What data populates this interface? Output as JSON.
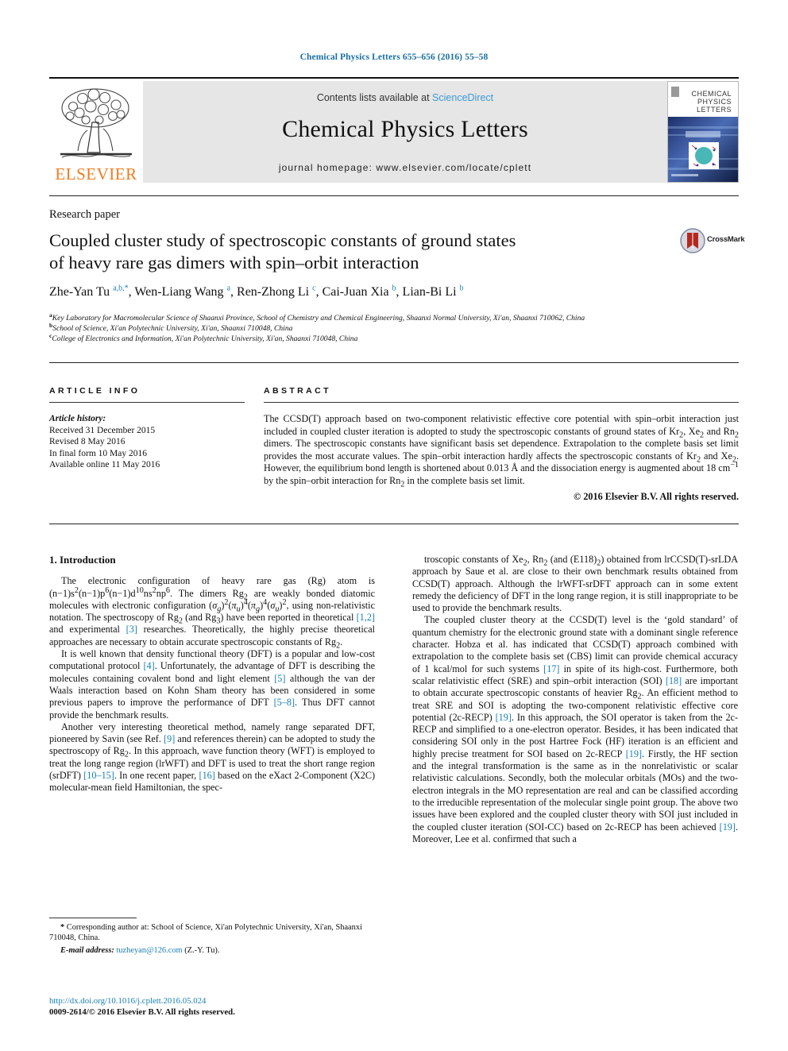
{
  "running_head": "Chemical Physics Letters 655–656 (2016) 55–58",
  "masthead": {
    "publisher_name": "ELSEVIER",
    "contents_prefix": "Contents lists available at ",
    "sciencedirect": "ScienceDirect",
    "journal_title": "Chemical Physics Letters",
    "homepage": "journal homepage: www.elsevier.com/locate/cplett",
    "cover_title_line1": "CHEMICAL",
    "cover_title_line2": "PHYSICS",
    "cover_title_line3": "LETTERS"
  },
  "article": {
    "type": "Research paper",
    "title_line1": "Coupled cluster study of spectroscopic constants of ground states",
    "title_line2": "of heavy rare gas dimers with spin–orbit interaction",
    "crossmark_label": "CrossMark",
    "authors_html": "Zhe-Yan Tu <sup>a,b,</sup><sup>*</sup>, Wen-Liang Wang <sup>a</sup>, Ren-Zhong Li <sup>c</sup>, Cai-Juan Xia <sup>b</sup>, Lian-Bi Li <sup>b</sup>",
    "affiliations": [
      {
        "mark": "a",
        "text": "Key Laboratory for Macromolecular Science of Shaanxi Province, School of Chemistry and Chemical Engineering, Shaanxi Normal University, Xi'an, Shaanxi 710062, China"
      },
      {
        "mark": "b",
        "text": "School of Science, Xi'an Polytechnic University, Xi'an, Shaanxi 710048, China"
      },
      {
        "mark": "c",
        "text": "College of Electronics and Information, Xi'an Polytechnic University, Xi'an, Shaanxi 710048, China"
      }
    ]
  },
  "article_info": {
    "heading": "ARTICLE INFO",
    "history_label": "Article history:",
    "history": [
      "Received 31 December 2015",
      "Revised 8 May 2016",
      "In final form 10 May 2016",
      "Available online 11 May 2016"
    ]
  },
  "abstract": {
    "heading": "ABSTRACT",
    "body_html": "The CCSD(T) approach based on two-component relativistic effective core potential with spin–orbit interaction just included in coupled cluster iteration is adopted to study the spectroscopic constants of ground states of Kr<sub>2</sub>, Xe<sub>2</sub> and Rn<sub>2</sub> dimers. The spectroscopic constants have significant basis set dependence. Extrapolation to the complete basis set limit provides the most accurate values. The spin–orbit interaction hardly affects the spectroscopic constants of Kr<sub>2</sub> and Xe<sub>2</sub>. However, the equilibrium bond length is shortened about 0.013 Å and the dissociation energy is augmented about 18 cm<sup>−1</sup> by the spin–orbit interaction for Rn<sub>2</sub> in the complete basis set limit.",
    "copyright": "© 2016 Elsevier B.V. All rights reserved."
  },
  "body": {
    "section_number_title": "1. Introduction",
    "left_paragraphs_html": [
      "The electronic configuration of heavy rare gas (Rg) atom is (n−1)s<sup>2</sup>(n−1)p<sup>6</sup>(n−1)d<sup>10</sup>ns<sup>2</sup>np<sup>6</sup>. The dimers Rg<sub>2</sub> are weakly bonded diatomic molecules with electronic configuration (<i>σ<sub>g</sub></i>)<sup>2</sup>(<i>π<sub>u</sub></i>)<sup>4</sup>(<i>π<sub>g</sub></i>)<sup>4</sup>(<i>σ<sub>u</sub></i>)<sup>2</sup>, using non-relativistic notation. The spectroscopy of Rg<sub>2</sub> (and Rg<sub>3</sub>) have been reported in theoretical <span class=\"ref\">[1,2]</span> and experimental <span class=\"ref\">[3]</span> researches. Theoretically, the highly precise theoretical approaches are necessary to obtain accurate spectroscopic constants of Rg<sub>2</sub>.",
      "It is well known that density functional theory (DFT) is a popular and low-cost computational protocol <span class=\"ref\">[4]</span>. Unfortunately, the advantage of DFT is describing the molecules containing covalent bond and light element <span class=\"ref\">[5]</span> although the van der Waals interaction based on Kohn Sham theory has been considered in some previous papers to improve the performance of DFT <span class=\"ref\">[5–8]</span>. Thus DFT cannot provide the benchmark results.",
      "Another very interesting theoretical method, namely range separated DFT, pioneered by Savin (see Ref. <span class=\"ref\">[9]</span> and references therein) can be adopted to study the spectroscopy of Rg<sub>2</sub>. In this approach, wave function theory (WFT) is employed to treat the long range region (lrWFT) and DFT is used to treat the short range region (srDFT) <span class=\"ref\">[10–15]</span>. In one recent paper, <span class=\"ref\">[16]</span> based on the eXact 2-Component (X2C) molecular-mean field Hamiltonian, the spec-"
    ],
    "right_paragraphs_html": [
      "troscopic constants of Xe<sub>2</sub>, Rn<sub>2</sub> (and (E118)<sub>2</sub>) obtained from lrCCSD(T)-srLDA approach by Saue et al. are close to their own benchmark results obtained from CCSD(T) approach. Although the lrWFT-srDFT approach can in some extent remedy the deficiency of DFT in the long range region, it is still inappropriate to be used to provide the benchmark results.",
      "The coupled cluster theory at the CCSD(T) level is the ‘gold standard’ of quantum chemistry for the electronic ground state with a dominant single reference character. Hobza et al. has indicated that CCSD(T) approach combined with extrapolation to the complete basis set (CBS) limit can provide chemical accuracy of 1 kcal/mol for such systems <span class=\"ref\">[17]</span> in spite of its high-cost. Furthermore, both scalar relativistic effect (SRE) and spin–orbit interaction (SOI) <span class=\"ref\">[18]</span> are important to obtain accurate spectroscopic constants of heavier Rg<sub>2</sub>. An efficient method to treat SRE and SOI is adopting the two-component relativistic effective core potential (2c-RECP) <span class=\"ref\">[19]</span>. In this approach, the SOI operator is taken from the 2c-RECP and simplified to a one-electron operator. Besides, it has been indicated that considering SOI only in the post Hartree Fock (HF) iteration is an efficient and highly precise treatment for SOI based on 2c-RECP <span class=\"ref\">[19]</span>. Firstly, the HF section and the integral transformation is the same as in the nonrelativistic or scalar relativistic calculations. Secondly, both the molecular orbitals (MOs) and the two-electron integrals in the MO representation are real and can be classified according to the irreducible representation of the molecular single point group. The above two issues have been explored and the coupled cluster theory with SOI just included in the coupled cluster iteration (SOI-CC) based on 2c-RECP has been achieved <span class=\"ref\">[19]</span>. Moreover, Lee et al. confirmed that such a"
    ]
  },
  "footnote": {
    "corresponding_html": "<span style=\"font-weight:bold\">*</span> Corresponding author at: School of Science, Xi'an Polytechnic University, Xi'an, Shaanxi 710048, China.",
    "email_label": "E-mail address:",
    "email": "tuzheyan@126.com",
    "email_suffix": "(Z.-Y. Tu)."
  },
  "footer": {
    "doi": "http://dx.doi.org/10.1016/j.cplett.2016.05.024",
    "issn_copyright": "0009-2614/© 2016 Elsevier B.V. All rights reserved."
  },
  "colors": {
    "link_blue": "#1a7fb5",
    "sciencedirect_blue": "#3a9ad9",
    "elsevier_orange": "#f07c1e",
    "masthead_gray": "#e6e6e6"
  }
}
